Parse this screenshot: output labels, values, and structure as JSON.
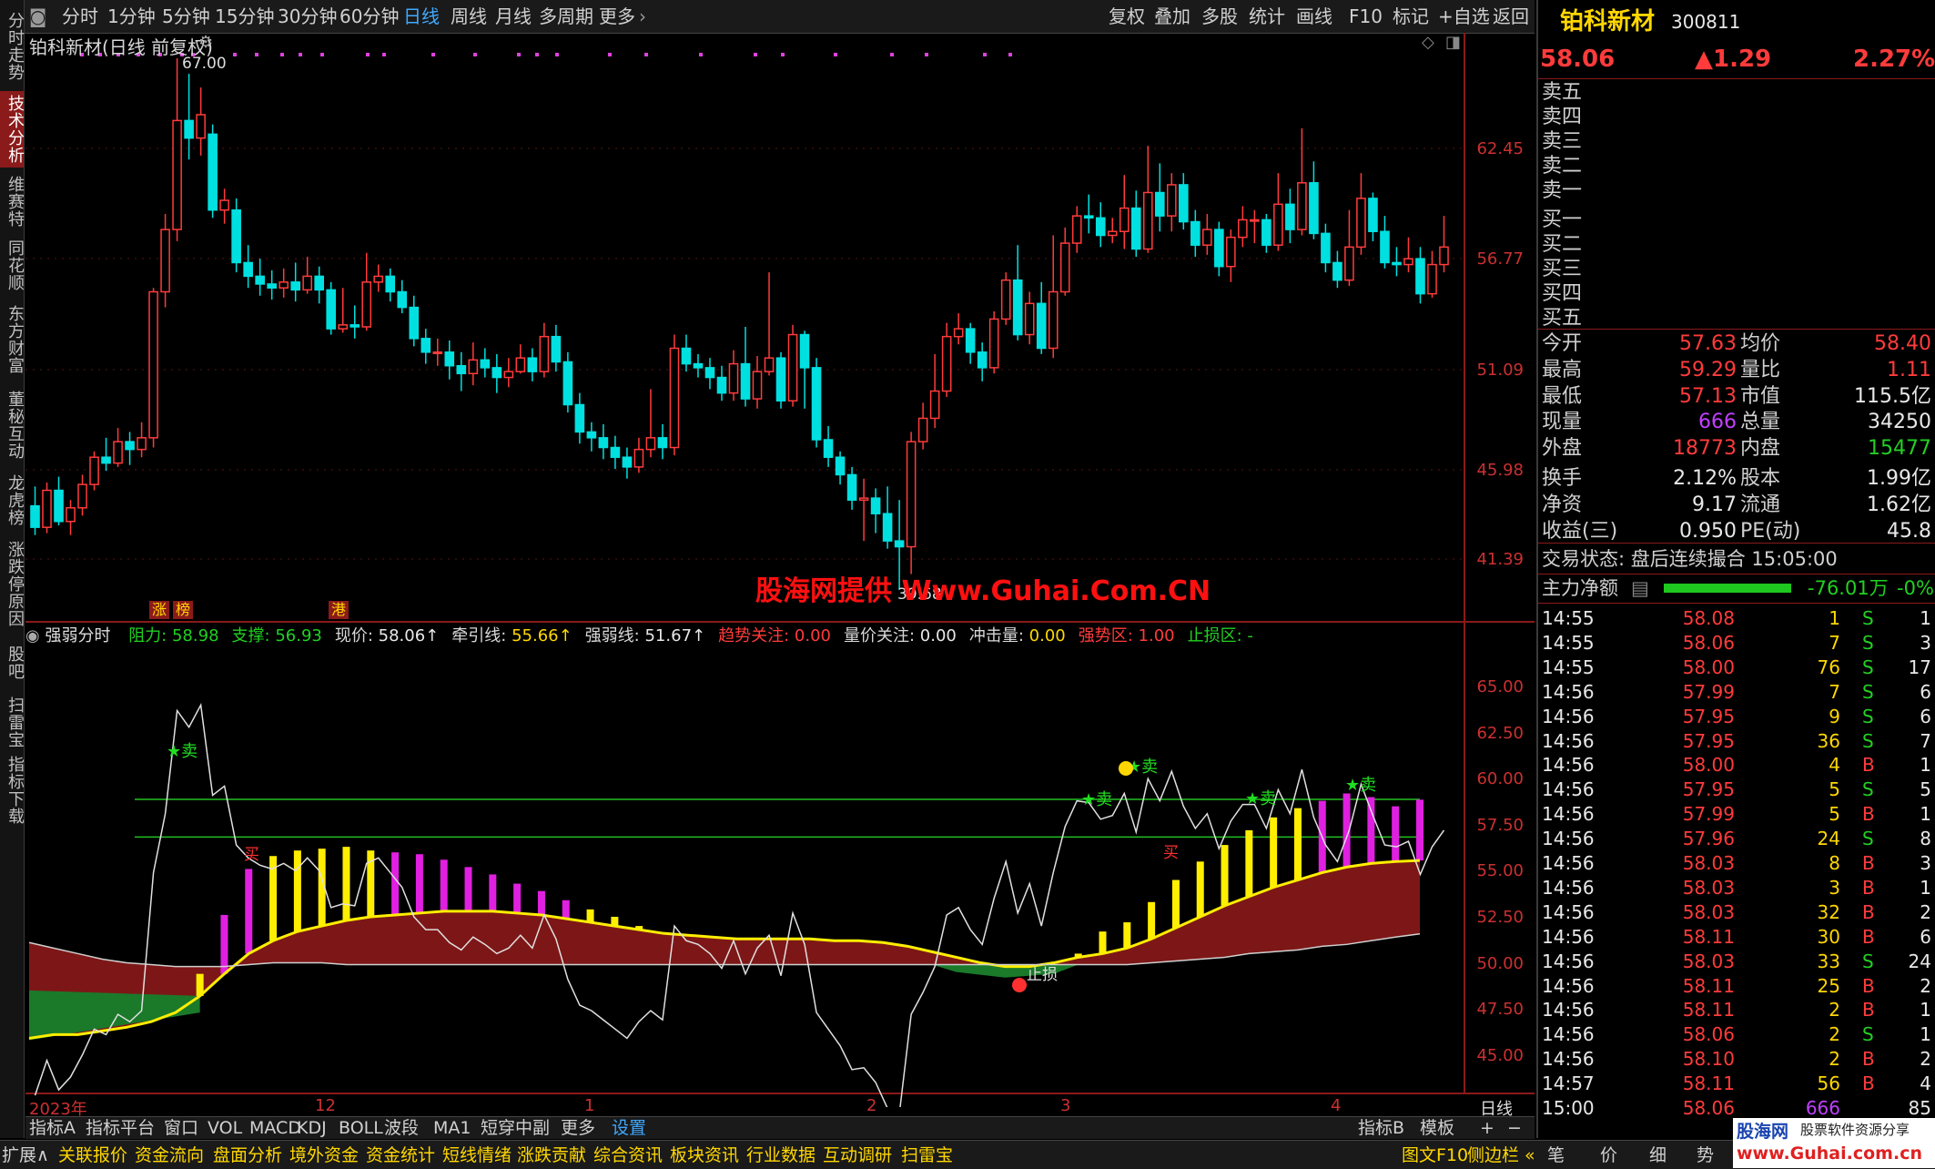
{
  "toolbar": {
    "periods": [
      "分时",
      "1分钟",
      "5分钟",
      "15分钟",
      "30分钟",
      "60分钟",
      "日线",
      "周线",
      "月线",
      "多周期",
      "更多"
    ],
    "active_period": "日线",
    "right_items": [
      "复权",
      "叠加",
      "多股",
      "统计",
      "画线",
      "F10",
      "标记",
      "+自选",
      "返回"
    ]
  },
  "left_tabs": [
    "分时走势",
    "技术分析",
    "维赛特",
    "同花顺",
    "东方财富",
    "董秘互动",
    "龙虎榜",
    "涨跌停原因",
    "股吧",
    "扫雷宝",
    "指标下载"
  ],
  "left_tab_active": "技术分析",
  "chart": {
    "title": "铂科新材(日线 前复权)",
    "price_high_label": "67.00",
    "price_low_label": "39.68",
    "y_labels_main": [
      "62.45",
      "56.77",
      "51.09",
      "45.98",
      "41.39"
    ],
    "y_labels_ind": [
      "65.00",
      "62.50",
      "60.00",
      "57.50",
      "55.00",
      "52.50",
      "50.00",
      "47.50",
      "45.00"
    ],
    "x_labels": [
      "2023年",
      "12",
      "1",
      "2",
      "3",
      "4"
    ],
    "period_label": "日线",
    "markers": {
      "zhang": "涨",
      "bang": "榜",
      "gang": "港"
    },
    "indicator_header": {
      "name": "强弱分时",
      "items": [
        {
          "label": "阻力: ",
          "value": "58.98",
          "color": "#22d022"
        },
        {
          "label": "支撑: ",
          "value": "56.93",
          "color": "#22d022"
        },
        {
          "label": "现价: ",
          "value": "58.06↑",
          "color": "#e8e8e8"
        },
        {
          "label": "牵引线: ",
          "value": "55.66↑",
          "color": "#ffd700"
        },
        {
          "label": "强弱线: ",
          "value": "51.67↑",
          "color": "#e8e8e8"
        },
        {
          "label": "趋势关注: ",
          "value": "0.00",
          "color": "#ff3b3b"
        },
        {
          "label": "量价关注: ",
          "value": "0.00",
          "color": "#e8e8e8"
        },
        {
          "label": "冲击量: ",
          "value": "0.00",
          "color": "#ffd700"
        },
        {
          "label": "强势区: ",
          "value": "1.00",
          "color": "#ff3b3b"
        },
        {
          "label": "止损区: ",
          "value": "-",
          "color": "#22d022"
        }
      ]
    },
    "signals": {
      "sell": "卖",
      "buy": "买",
      "stoploss": "止损"
    }
  },
  "watermark": "股海网提供 Www.Guhai.Com.CN",
  "indicator_tabs": [
    "指标A",
    "指标平台",
    "窗口",
    "VOL",
    "MACD",
    "KDJ",
    "BOLL",
    "波段",
    "MA1",
    "短穿中副",
    "更多",
    "设置"
  ],
  "indicator_tabs_right": [
    "指标B",
    "模板",
    "+",
    "−"
  ],
  "bottom_tabs": [
    "扩展∧",
    "关联报价",
    "资金流向",
    "盘面分析",
    "境外资金",
    "资金统计",
    "短线情绪",
    "涨跌贡献",
    "综合资讯",
    "板块资讯",
    "行业数据",
    "互动调研",
    "扫雷宝"
  ],
  "bottom_right": [
    "图文F10",
    "侧边栏 «",
    "笔",
    "价",
    "细",
    "势"
  ],
  "stock": {
    "name": "铂科新材",
    "code": "300811",
    "price": "58.06",
    "change": "▲1.29",
    "change_pct": "2.27%",
    "order_book": [
      "卖五",
      "卖四",
      "卖三",
      "卖二",
      "卖一",
      "买一",
      "买二",
      "买三",
      "买四",
      "买五"
    ],
    "stats": [
      {
        "l1": "今开",
        "v1": "57.63",
        "c1": "red",
        "l2": "均价",
        "v2": "58.40",
        "c2": "red"
      },
      {
        "l1": "最高",
        "v1": "59.29",
        "c1": "red",
        "l2": "量比",
        "v2": "1.11",
        "c2": "red"
      },
      {
        "l1": "最低",
        "v1": "57.13",
        "c1": "red",
        "l2": "市值",
        "v2": "115.5亿",
        "c2": "white"
      },
      {
        "l1": "现量",
        "v1": "666",
        "c1": "purple",
        "l2": "总量",
        "v2": "34250",
        "c2": "white"
      },
      {
        "l1": "外盘",
        "v1": "18773",
        "c1": "red",
        "l2": "内盘",
        "v2": "15477",
        "c2": "green"
      },
      {
        "l1": "换手",
        "v1": "2.12%",
        "c1": "white",
        "l2": "股本",
        "v2": "1.99亿",
        "c2": "white"
      },
      {
        "l1": "净资",
        "v1": "9.17",
        "c1": "white",
        "l2": "流通",
        "v2": "1.62亿",
        "c2": "white"
      },
      {
        "l1": "收益(三)",
        "v1": "0.950",
        "c1": "white",
        "l2": "PE(动)",
        "v2": "45.8",
        "c2": "white"
      }
    ],
    "trade_status": "交易状态: 盘后连续撮合 15:05:00",
    "main_flow_label": "主力净额",
    "main_flow_value": "-76.01万",
    "main_flow_pct": "-0%",
    "ticks": [
      {
        "t": "14:55",
        "p": "58.08",
        "v": "1",
        "s": "S",
        "n": "1"
      },
      {
        "t": "14:55",
        "p": "58.06",
        "v": "7",
        "s": "S",
        "n": "3"
      },
      {
        "t": "14:55",
        "p": "58.00",
        "v": "76",
        "s": "S",
        "n": "17"
      },
      {
        "t": "14:56",
        "p": "57.99",
        "v": "7",
        "s": "S",
        "n": "6"
      },
      {
        "t": "14:56",
        "p": "57.95",
        "v": "9",
        "s": "S",
        "n": "6"
      },
      {
        "t": "14:56",
        "p": "57.95",
        "v": "36",
        "s": "S",
        "n": "7"
      },
      {
        "t": "14:56",
        "p": "58.00",
        "v": "4",
        "s": "B",
        "n": "1"
      },
      {
        "t": "14:56",
        "p": "57.95",
        "v": "5",
        "s": "S",
        "n": "5"
      },
      {
        "t": "14:56",
        "p": "57.99",
        "v": "5",
        "s": "B",
        "n": "1"
      },
      {
        "t": "14:56",
        "p": "57.96",
        "v": "24",
        "s": "S",
        "n": "8"
      },
      {
        "t": "14:56",
        "p": "58.03",
        "v": "8",
        "s": "B",
        "n": "3"
      },
      {
        "t": "14:56",
        "p": "58.03",
        "v": "3",
        "s": "B",
        "n": "1"
      },
      {
        "t": "14:56",
        "p": "58.03",
        "v": "32",
        "s": "B",
        "n": "2"
      },
      {
        "t": "14:56",
        "p": "58.11",
        "v": "30",
        "s": "B",
        "n": "6"
      },
      {
        "t": "14:56",
        "p": "58.03",
        "v": "33",
        "s": "S",
        "n": "24"
      },
      {
        "t": "14:56",
        "p": "58.11",
        "v": "25",
        "s": "B",
        "n": "2"
      },
      {
        "t": "14:56",
        "p": "58.11",
        "v": "2",
        "s": "B",
        "n": "1"
      },
      {
        "t": "14:56",
        "p": "58.06",
        "v": "2",
        "s": "S",
        "n": "1"
      },
      {
        "t": "14:56",
        "p": "58.10",
        "v": "2",
        "s": "B",
        "n": "2"
      },
      {
        "t": "14:57",
        "p": "58.11",
        "v": "56",
        "s": "B",
        "n": "4"
      },
      {
        "t": "15:00",
        "p": "58.06",
        "v": "666",
        "s": "",
        "n": "85"
      }
    ]
  },
  "logo": {
    "name": "股海网",
    "tagline": "股票软件资源分享",
    "url": "www.Guhai.com.cn"
  },
  "chart_data": {
    "type": "candlestick",
    "title": "铂科新材(日线 前复权)",
    "x_labels": [
      "2023年",
      "12",
      "1",
      "2",
      "3",
      "4"
    ],
    "ylim": [
      39.68,
      67.0
    ],
    "candles": [
      [
        44.0,
        42.9,
        45.0,
        42.5
      ],
      [
        42.9,
        44.8,
        45.2,
        42.6
      ],
      [
        44.8,
        43.2,
        45.5,
        43.0
      ],
      [
        43.2,
        43.9,
        44.3,
        42.5
      ],
      [
        43.9,
        45.1,
        45.6,
        43.5
      ],
      [
        45.1,
        46.5,
        46.8,
        44.8
      ],
      [
        46.5,
        46.2,
        47.5,
        45.8
      ],
      [
        46.2,
        47.3,
        48.0,
        46.0
      ],
      [
        47.3,
        46.9,
        47.8,
        46.1
      ],
      [
        46.9,
        47.5,
        48.3,
        46.5
      ],
      [
        47.5,
        55.0,
        55.2,
        47.0
      ],
      [
        55.0,
        58.2,
        59.0,
        54.2
      ],
      [
        58.2,
        63.8,
        67.0,
        57.6
      ],
      [
        63.8,
        62.9,
        66.2,
        61.8
      ],
      [
        62.9,
        64.1,
        65.5,
        62.0
      ],
      [
        63.1,
        59.2,
        63.6,
        58.8
      ],
      [
        59.2,
        59.7,
        60.3,
        58.5
      ],
      [
        59.2,
        56.5,
        59.8,
        56.0
      ],
      [
        56.5,
        55.8,
        57.4,
        55.2
      ],
      [
        55.8,
        55.4,
        56.7,
        54.8
      ],
      [
        55.4,
        55.2,
        56.1,
        54.6
      ],
      [
        55.2,
        55.5,
        56.2,
        54.7
      ],
      [
        55.5,
        55.1,
        56.5,
        54.5
      ],
      [
        55.1,
        55.8,
        56.8,
        54.9
      ],
      [
        55.8,
        55.1,
        56.3,
        54.4
      ],
      [
        55.1,
        53.1,
        55.5,
        52.8
      ],
      [
        53.1,
        53.3,
        55.2,
        52.9
      ],
      [
        53.3,
        53.2,
        54.3,
        52.6
      ],
      [
        53.2,
        55.5,
        57.0,
        53.0
      ],
      [
        55.5,
        55.8,
        56.4,
        55.0
      ],
      [
        55.8,
        55.0,
        56.2,
        54.5
      ],
      [
        55.0,
        54.2,
        55.6,
        53.9
      ],
      [
        54.2,
        52.6,
        54.8,
        52.2
      ],
      [
        52.6,
        51.9,
        53.1,
        51.3
      ],
      [
        51.9,
        51.9,
        52.6,
        51.2
      ],
      [
        51.9,
        51.2,
        52.5,
        50.5
      ],
      [
        51.2,
        50.8,
        51.9,
        49.9
      ],
      [
        50.8,
        51.5,
        52.4,
        50.2
      ],
      [
        51.5,
        51.1,
        52.1,
        50.6
      ],
      [
        51.1,
        50.6,
        51.8,
        49.8
      ],
      [
        50.6,
        50.9,
        51.6,
        50.1
      ],
      [
        50.9,
        51.6,
        52.3,
        50.8
      ],
      [
        51.6,
        50.9,
        52.1,
        50.4
      ],
      [
        50.9,
        52.7,
        53.4,
        50.6
      ],
      [
        52.7,
        51.4,
        53.3,
        50.9
      ],
      [
        51.4,
        49.2,
        51.9,
        48.8
      ],
      [
        49.2,
        47.8,
        49.8,
        47.2
      ],
      [
        47.8,
        47.5,
        48.3,
        46.8
      ],
      [
        47.5,
        47.0,
        48.2,
        46.4
      ],
      [
        47.0,
        46.5,
        47.6,
        45.9
      ],
      [
        46.5,
        46.0,
        47.0,
        45.4
      ],
      [
        46.0,
        46.9,
        47.5,
        45.7
      ],
      [
        46.9,
        47.5,
        50.0,
        46.5
      ],
      [
        47.5,
        47.0,
        48.2,
        46.4
      ],
      [
        47.0,
        52.1,
        52.8,
        46.6
      ],
      [
        52.1,
        51.3,
        52.8,
        50.9
      ],
      [
        51.3,
        51.1,
        51.8,
        50.6
      ],
      [
        51.1,
        50.6,
        51.6,
        50.0
      ],
      [
        50.6,
        49.8,
        51.2,
        49.4
      ],
      [
        49.8,
        51.3,
        52.0,
        49.4
      ],
      [
        51.3,
        49.5,
        53.2,
        49.1
      ],
      [
        49.5,
        50.9,
        51.7,
        49.0
      ],
      [
        50.9,
        51.6,
        56.0,
        50.7
      ],
      [
        51.6,
        49.4,
        51.9,
        49.0
      ],
      [
        49.4,
        52.8,
        53.3,
        49.1
      ],
      [
        52.8,
        51.1,
        53.0,
        49.0
      ],
      [
        51.1,
        47.4,
        51.6,
        47.0
      ],
      [
        47.4,
        46.5,
        48.1,
        46.0
      ],
      [
        46.5,
        45.6,
        46.8,
        45.1
      ],
      [
        45.6,
        44.3,
        46.0,
        43.8
      ],
      [
        44.3,
        44.4,
        45.4,
        42.2
      ],
      [
        44.4,
        43.6,
        44.9,
        42.6
      ],
      [
        43.6,
        42.2,
        45.0,
        41.8
      ],
      [
        42.2,
        41.9,
        44.3,
        39.68
      ],
      [
        41.9,
        47.3,
        47.8,
        40.5
      ],
      [
        47.3,
        48.5,
        49.3,
        46.9
      ],
      [
        48.5,
        49.9,
        51.8,
        48.0
      ],
      [
        49.9,
        52.7,
        53.4,
        49.6
      ],
      [
        52.7,
        53.1,
        53.9,
        52.3
      ],
      [
        53.1,
        51.9,
        53.4,
        51.3
      ],
      [
        51.9,
        51.1,
        52.4,
        50.4
      ],
      [
        51.1,
        53.6,
        54.0,
        50.8
      ],
      [
        53.6,
        55.6,
        56.0,
        53.3
      ],
      [
        55.6,
        52.8,
        57.4,
        52.5
      ],
      [
        52.8,
        54.4,
        55.0,
        52.3
      ],
      [
        54.4,
        52.1,
        55.5,
        51.8
      ],
      [
        52.1,
        55.0,
        57.9,
        51.6
      ],
      [
        55.0,
        57.5,
        58.3,
        54.8
      ],
      [
        57.5,
        58.9,
        59.4,
        57.0
      ],
      [
        58.9,
        58.8,
        60.0,
        58.0
      ],
      [
        58.8,
        57.9,
        59.6,
        57.3
      ],
      [
        57.9,
        58.1,
        58.8,
        57.5
      ],
      [
        58.1,
        59.3,
        61.0,
        57.2
      ],
      [
        59.3,
        57.2,
        60.2,
        56.8
      ],
      [
        57.2,
        60.1,
        62.5,
        57.0
      ],
      [
        60.1,
        58.9,
        61.6,
        58.1
      ],
      [
        58.9,
        60.5,
        61.1,
        58.1
      ],
      [
        60.5,
        58.6,
        61.1,
        58.2
      ],
      [
        58.6,
        57.4,
        59.2,
        56.8
      ],
      [
        57.4,
        58.2,
        59.0,
        56.9
      ],
      [
        58.2,
        56.3,
        58.6,
        55.8
      ],
      [
        56.3,
        57.8,
        58.2,
        55.5
      ],
      [
        57.8,
        58.7,
        59.4,
        57.3
      ],
      [
        58.7,
        58.7,
        59.2,
        57.5
      ],
      [
        58.7,
        57.4,
        59.0,
        57.0
      ],
      [
        57.4,
        59.5,
        61.1,
        57.1
      ],
      [
        59.5,
        58.2,
        60.3,
        57.5
      ],
      [
        58.2,
        60.6,
        63.4,
        57.9
      ],
      [
        60.6,
        58.0,
        61.7,
        57.7
      ],
      [
        58.0,
        56.5,
        58.5,
        56.0
      ],
      [
        56.5,
        55.6,
        57.1,
        55.2
      ],
      [
        55.6,
        57.3,
        59.2,
        55.3
      ],
      [
        57.3,
        59.8,
        61.1,
        56.9
      ],
      [
        59.8,
        58.1,
        60.1,
        57.6
      ],
      [
        58.1,
        56.5,
        58.9,
        56.2
      ],
      [
        56.5,
        56.4,
        57.3,
        55.8
      ],
      [
        56.4,
        56.7,
        57.8,
        56.0
      ],
      [
        56.7,
        54.9,
        57.3,
        54.4
      ],
      [
        54.9,
        56.4,
        57.1,
        54.7
      ],
      [
        56.4,
        57.3,
        58.9,
        56.0
      ]
    ]
  }
}
